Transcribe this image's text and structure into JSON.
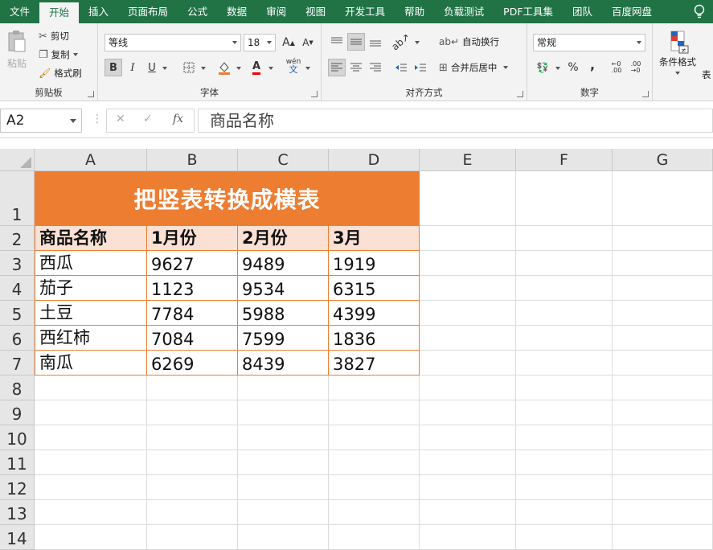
{
  "menubar": {
    "tabs": [
      "文件",
      "开始",
      "插入",
      "页面布局",
      "公式",
      "数据",
      "审阅",
      "视图",
      "开发工具",
      "帮助",
      "负载测试",
      "PDF工具集",
      "团队",
      "百度网盘"
    ],
    "active": "开始"
  },
  "ribbon": {
    "clipboard": {
      "label": "剪贴板",
      "paste": "粘贴",
      "cut": "剪切",
      "copy": "复制",
      "format_painter": "格式刷"
    },
    "font": {
      "label": "字体",
      "font_name": "等线",
      "font_size": "18",
      "bold": "B",
      "italic": "I",
      "underline": "U",
      "grow": "A",
      "shrink": "A",
      "font_color_letter": "A",
      "wen": "wén"
    },
    "alignment": {
      "label": "对齐方式",
      "wrap": "自动换行",
      "merge": "合并后居中"
    },
    "number": {
      "label": "数字",
      "format": "常规",
      "percent": "%",
      "comma": ","
    },
    "styles": {
      "conditional": "条件格式",
      "table_partial": "表"
    }
  },
  "formula_bar": {
    "name_box": "A2",
    "content": "商品名称"
  },
  "sheet": {
    "columns": [
      "A",
      "B",
      "C",
      "D",
      "E",
      "F",
      "G"
    ],
    "rows": [
      "1",
      "2",
      "3",
      "4",
      "5",
      "6",
      "7",
      "8",
      "9",
      "10",
      "11",
      "12",
      "13",
      "14"
    ],
    "title": "把竖表转换成横表",
    "header": [
      "商品名称",
      "1月份",
      "2月份",
      "3月"
    ],
    "data": [
      [
        "西瓜",
        "9627",
        "9489",
        "1919"
      ],
      [
        "茄子",
        "1123",
        "9534",
        "6315"
      ],
      [
        "土豆",
        "7784",
        "5988",
        "4399"
      ],
      [
        "西红柿",
        "7084",
        "7599",
        "1836"
      ],
      [
        "南瓜",
        "6269",
        "8439",
        "3827"
      ]
    ]
  },
  "colors": {
    "excel_green": "#217346",
    "title_fill": "#ed7d31",
    "header_fill": "#fbe1d3"
  }
}
